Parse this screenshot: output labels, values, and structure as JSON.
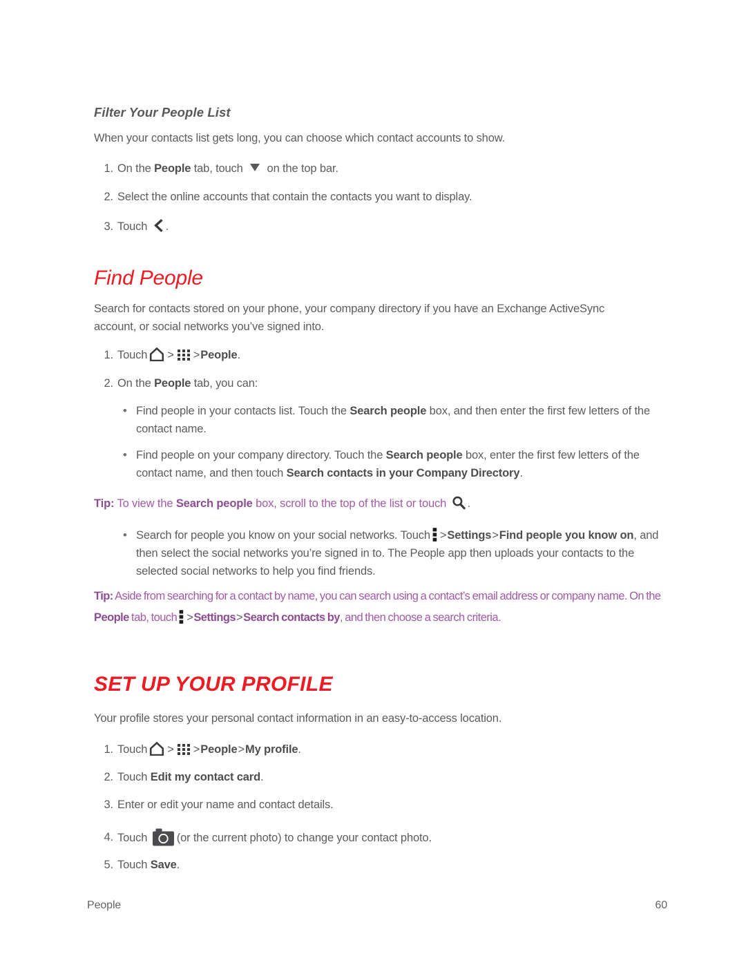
{
  "document": {
    "footer_section": "People",
    "page_number": "60",
    "colors": {
      "heading_red": "#ec1c24",
      "tip_purple": "#a35aa6",
      "body_gray": "#5b5c5e",
      "bold_gray": "#4d4e50"
    }
  },
  "filter_section": {
    "heading": "Filter Your People List",
    "intro": "When your contacts list gets long, you can choose which contact accounts to show.",
    "steps": [
      {
        "number": "1.",
        "pre": "On the ",
        "bold1": "People",
        "mid": " tab, touch ",
        "icon": "triangle-down-icon",
        "post": " on the top bar."
      },
      {
        "number": "2.",
        "text": "Select the online accounts that contain the contacts you want to display."
      },
      {
        "number": "3.",
        "pre": "Touch ",
        "icon": "back-chevron-icon",
        "post": "."
      }
    ]
  },
  "find_people_section": {
    "heading": "Find People",
    "intro": "Search for contacts stored on your phone, your company directory if you have an Exchange ActiveSync account, or social networks you’ve signed into.",
    "step1": {
      "number": "1.",
      "pre": "Touch",
      "icon_home": "home-icon",
      "sep1": ">",
      "icon_apps": "apps-grid-icon",
      "sep2": ">",
      "bold1": "People",
      "post": "."
    },
    "step2": {
      "number": "2.",
      "pre": "On the ",
      "bold1": "People",
      "post": " tab, you can:"
    },
    "bullets": [
      {
        "marker": "•",
        "pre": "Find people in your contacts list. Touch the ",
        "bold1": "Search people",
        "post": " box, and then enter the first few letters of the contact name."
      },
      {
        "marker": "•",
        "pre": "Find people on your company directory. Touch the ",
        "bold1": "Search people",
        "mid": " box, enter the first few letters of the contact name, and then touch ",
        "bold2": "Search contacts in your Company Directory",
        "post": "."
      }
    ],
    "tip1": {
      "label": "Tip:",
      "pre": " To view the ",
      "bold1": "Search people",
      "mid": " box, scroll to the top of the list or touch ",
      "icon": "search-icon",
      "post": "."
    },
    "bullet3": {
      "marker": "•",
      "pre": "Search for people you know on your social networks. Touch",
      "icon": "overflow-menu-icon",
      "sep1": ">",
      "bold1": "Settings",
      "sep2": ">",
      "bold2": "Find people you know on",
      "post": ", and then select the social networks you’re signed in to. The People app then uploads your contacts to the selected social networks to help you find friends."
    },
    "tip2": {
      "label": "Tip:",
      "pre": " Aside from searching for a contact by name, you can search using a contact’s email address or company name. On the ",
      "bold1": "People",
      "mid": " tab, touch",
      "icon": "overflow-menu-icon",
      "sep1": ">",
      "bold2": "Settings",
      "sep2": ">",
      "bold3": "Search contacts by",
      "post": ", and then choose a search criteria."
    }
  },
  "profile_section": {
    "heading": "SET UP YOUR PROFILE",
    "intro": "Your profile stores your personal contact information in an easy-to-access location.",
    "step1": {
      "number": "1.",
      "pre": "Touch",
      "icon_home": "home-icon",
      "sep1": ">",
      "icon_apps": "apps-grid-icon",
      "sep2": ">",
      "bold1": "People",
      "sep3": ">",
      "bold2": "My profile",
      "post": "."
    },
    "step2": {
      "number": "2.",
      "pre": "Touch ",
      "bold1": "Edit my contact card",
      "post": "."
    },
    "step3": {
      "number": "3.",
      "text": "Enter or edit your name and contact details."
    },
    "step4": {
      "number": "4.",
      "pre": "Touch ",
      "icon": "camera-icon",
      "post": "(or the current photo) to change your contact photo."
    },
    "step5": {
      "number": "5.",
      "pre": "Touch ",
      "bold1": "Save",
      "post": "."
    }
  }
}
